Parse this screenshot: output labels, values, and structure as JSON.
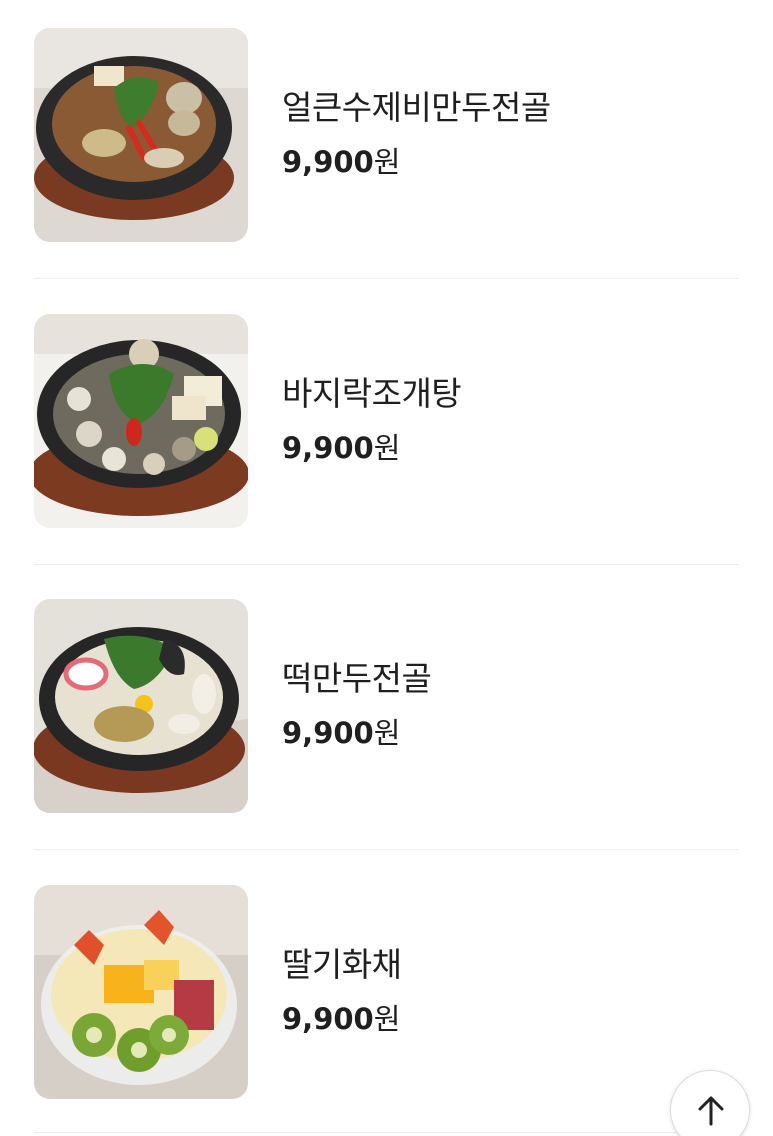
{
  "menu": {
    "items": [
      {
        "name": "얼큰수제비만두전골",
        "price": "9,900",
        "unit": "원",
        "image_icon": "hotpot-food-photo"
      },
      {
        "name": "바지락조개탕",
        "price": "9,900",
        "unit": "원",
        "image_icon": "clam-soup-food-photo"
      },
      {
        "name": "떡만두전골",
        "price": "9,900",
        "unit": "원",
        "image_icon": "rice-cake-dumpling-hotpot-food-photo"
      },
      {
        "name": "딸기화채",
        "price": "9,900",
        "unit": "원",
        "image_icon": "strawberry-fruit-punch-food-photo"
      }
    ]
  },
  "scroll_top": {
    "icon": "arrow-up-icon"
  },
  "colors": {
    "text": "#1f1f1f",
    "divider": "#eeeeee",
    "background": "#ffffff"
  }
}
